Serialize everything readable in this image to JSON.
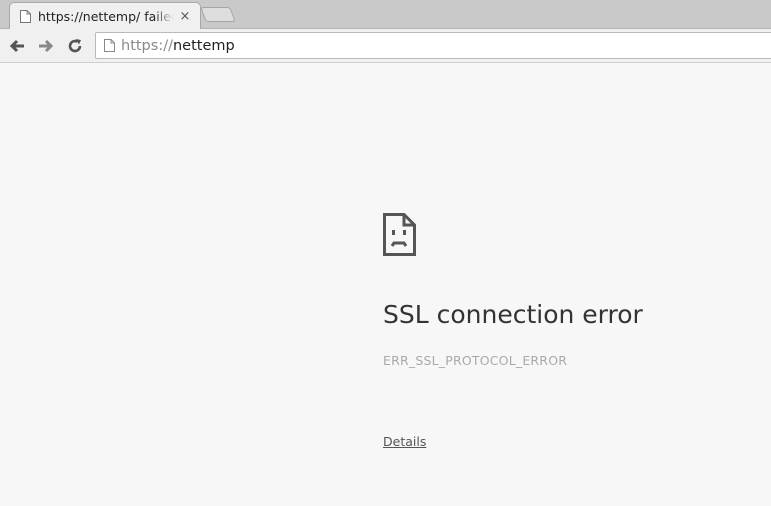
{
  "tab": {
    "title": "https://nettemp/ failed",
    "close_glyph": "×",
    "favicon": "page-icon"
  },
  "toolbar": {
    "back_icon": "back-arrow-icon",
    "forward_icon": "forward-arrow-icon",
    "reload_icon": "reload-icon"
  },
  "omnibox": {
    "scheme": "https://",
    "host": "nettemp",
    "page_icon": "page-icon"
  },
  "error": {
    "icon": "sad-page-icon",
    "title": "SSL connection error",
    "code": "ERR_SSL_PROTOCOL_ERROR",
    "details_label": "Details"
  }
}
